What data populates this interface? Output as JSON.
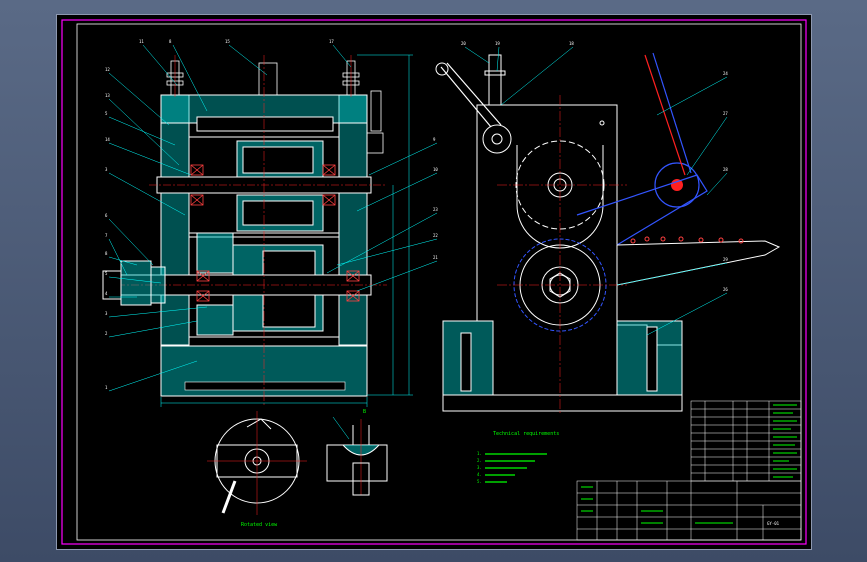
{
  "colors": {
    "background": "#000000",
    "border": "#ff00ff",
    "outline": "#ffffff",
    "hatch": "#00c8c8",
    "center_line": "#ff2020",
    "leader": "#00ffff",
    "dimension": "#00ffff",
    "blue_hidden": "#3355ff",
    "tech_text": "#00ff00",
    "title_block": "#ffffff"
  },
  "views": {
    "front": {
      "balloons": [
        "11",
        "8",
        "15",
        "17",
        "12",
        "13",
        "5",
        "14",
        "3",
        "6",
        "7",
        "8",
        "5",
        "4",
        "3",
        "2",
        "1",
        "9",
        "10",
        "23",
        "22",
        "21"
      ]
    },
    "side": {
      "balloons": [
        "20",
        "19",
        "18",
        "24",
        "27",
        "28",
        "29",
        "26"
      ]
    },
    "detail_a": {
      "label": "Rotated view"
    },
    "detail_b": {
      "label": "B"
    }
  },
  "technical_requirements": {
    "title": "Technical requirements",
    "lines": [
      "1. ",
      "2. ",
      "3. ",
      "4. ",
      "5. "
    ]
  },
  "title_block": {
    "drawing_number": "GY-01"
  }
}
